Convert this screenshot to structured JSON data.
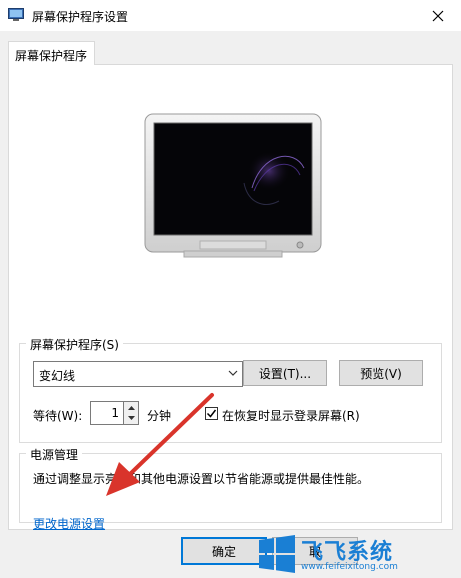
{
  "window": {
    "title": "屏幕保护程序设置"
  },
  "tabs": [
    {
      "label": "屏幕保护程序"
    }
  ],
  "screensaver": {
    "group_label": "屏幕保护程序(S)",
    "selected": "变幻线",
    "settings_label": "设置(T)...",
    "preview_label": "预览(V)",
    "wait_label": "等待(W):",
    "wait_value": "1",
    "minutes_label": "分钟",
    "resume_label": "在恢复时显示登录屏幕(R)",
    "resume_checked": true
  },
  "power": {
    "group_label": "电源管理",
    "description": "通过调整显示亮度和其他电源设置以节省能源或提供最佳性能。",
    "link_label": "更改电源设置"
  },
  "footer": {
    "ok_label": "确定",
    "cancel_label": "取"
  },
  "watermark": {
    "title": "飞飞系统",
    "url": "www.feifeixitong.com"
  },
  "icons": {
    "app": "monitor-icon",
    "close": "close-icon",
    "chevron": "chevron-down-icon",
    "spin_up": "spin-up-icon",
    "spin_down": "spin-down-icon",
    "checkmark": "checkmark-icon",
    "windows_logo": "windows-logo-icon"
  },
  "colors": {
    "accent": "#0078d7",
    "link": "#0066cc",
    "annotation_arrow": "#d9342b",
    "watermark": "#1a7fd4"
  }
}
